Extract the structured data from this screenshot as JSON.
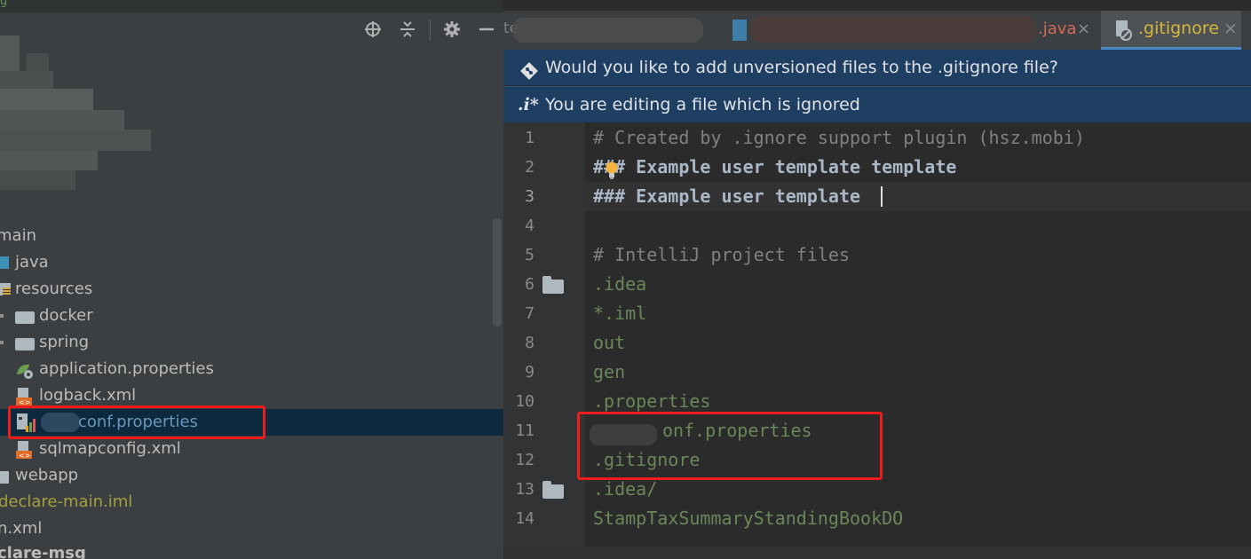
{
  "left_top_text": "g",
  "toolbar": {
    "locate_icon": "crosshair-icon",
    "collapse_icon": "collapse-all-icon",
    "settings_icon": "gear-icon",
    "hide_icon": "minus-icon"
  },
  "tree": {
    "items": [
      {
        "label": "main",
        "icon": "none",
        "color": "#bbbbbb"
      },
      {
        "label": "java",
        "icon": "source-folder-icon",
        "color": "#bbbbbb"
      },
      {
        "label": "resources",
        "icon": "resources-folder-icon",
        "color": "#bbbbbb"
      },
      {
        "label": "docker",
        "icon": "folder-icon",
        "color": "#bbbbbb"
      },
      {
        "label": "spring",
        "icon": "folder-icon",
        "color": "#bbbbbb"
      },
      {
        "label": "application.properties",
        "icon": "spring-properties-icon",
        "color": "#bbbbbb"
      },
      {
        "label": "logback.xml",
        "icon": "xml-file-icon",
        "color": "#bbbbbb"
      },
      {
        "label": "conf.properties",
        "icon": "properties-file-icon",
        "color": "#6897bb"
      },
      {
        "label": "sqlmapconfig.xml",
        "icon": "xml-file-icon",
        "color": "#bbbbbb"
      },
      {
        "label": "webapp",
        "icon": "folder-icon",
        "color": "#bbbbbb"
      },
      {
        "label": "declare-main.iml",
        "icon": "none",
        "color": "#a1a13d"
      },
      {
        "label": "n.xml",
        "icon": "none",
        "color": "#bbbbbb"
      },
      {
        "label": "clare-msg",
        "icon": "none",
        "color": "#bbbbbb"
      }
    ]
  },
  "tabs": {
    "java_tab_label": ".java",
    "gitignore_tab_label": ".gitignore",
    "close_glyph": "×",
    "partial_tab_label": "te"
  },
  "banners": {
    "unversioned_text": "Would you like to add unversioned files to the .gitignore file?",
    "ignored_prefix": ".i*",
    "ignored_text": "You are editing a file which is ignored"
  },
  "editor": {
    "lines": [
      {
        "num": "1",
        "text": "# Created by .ignore support plugin (hsz.mobi)",
        "style": "comment"
      },
      {
        "num": "2",
        "text": "### Example user template template",
        "style": "bold"
      },
      {
        "num": "3",
        "text": "### Example user template",
        "style": "bold"
      },
      {
        "num": "4",
        "text": "",
        "style": "plain"
      },
      {
        "num": "5",
        "text": "# IntelliJ project files",
        "style": "comment"
      },
      {
        "num": "6",
        "text": ".idea",
        "style": "green"
      },
      {
        "num": "7",
        "text": "*.iml",
        "style": "green"
      },
      {
        "num": "8",
        "text": "out",
        "style": "green"
      },
      {
        "num": "9",
        "text": "gen",
        "style": "green"
      },
      {
        "num": "10",
        "text": ".properties",
        "style": "green"
      },
      {
        "num": "11",
        "text": "onf.properties",
        "style": "green"
      },
      {
        "num": "12",
        "text": ".gitignore",
        "style": "green"
      },
      {
        "num": "13",
        "text": ".idea/",
        "style": "green"
      },
      {
        "num": "14",
        "text": "StampTaxSummaryStandingBookDO",
        "style": "green"
      }
    ]
  },
  "colors": {
    "highlight_box": "#ee1c1c",
    "banner_bg": "#1f3f62",
    "selection_bg": "#0d293e"
  }
}
